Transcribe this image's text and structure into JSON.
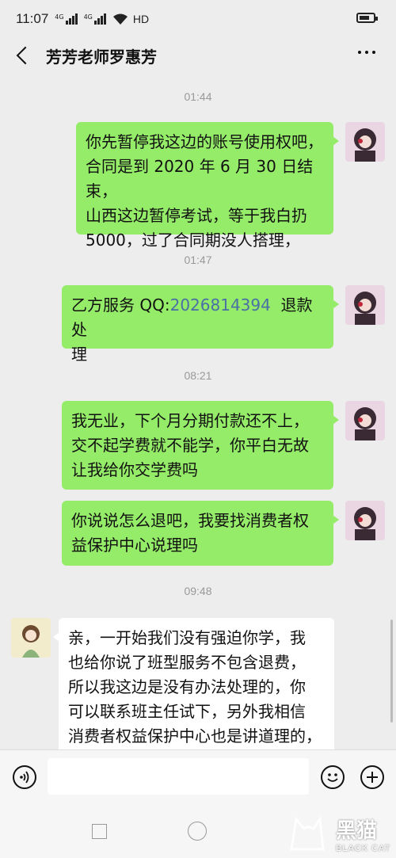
{
  "status": {
    "time": "11:07",
    "net1": "4G",
    "net2": "4G",
    "hd": "HD"
  },
  "header": {
    "title": "芳芳老师罗惠芳"
  },
  "messages": [
    {
      "time": "01:44",
      "text": "你先暂停我这边的账号使用权吧，合同是到 2020 年 6 月 30 日结束，山西这边暂停考试，等于我白扔 5000，过了合同期没人搭理，",
      "lines": [
        "你先暂停我这边的账号使用权吧，",
        "合同是到 2020 年 6 月 30 日结束，",
        "山西这边暂停考试，等于我白扔",
        "5000，过了合同期没人搭理，"
      ]
    },
    {
      "time": "01:47",
      "prefix": "乙方服务 QQ:",
      "qq": "2026814394",
      "suffix": " 退款处理",
      "line2": "理"
    },
    {
      "time": "08:21",
      "lines": [
        "我无业，下个月分期付款还不上，",
        "交不起学费就不能学，你平白无故",
        "让我给你交学费吗"
      ]
    },
    {
      "lines": [
        "你说说怎么退吧，我要找消费者权",
        "益保护中心说理吗"
      ]
    },
    {
      "time": "09:48",
      "lines": [
        "亲，一开始我们没有强迫你学，我",
        "也给你说了班型服务不包含退费，",
        "所以我这边是没有办法处理的，你",
        "可以联系班主任试下，另外我相信",
        "消费者权益保护中心也是讲道理的，"
      ]
    }
  ],
  "ts": [
    "01:44",
    "01:47",
    "08:21",
    "09:48"
  ],
  "watermark": {
    "big": "黑猫",
    "small": "BLACK CAT"
  },
  "icons": [
    "back-icon",
    "more-icon",
    "voice-icon",
    "emoji-icon",
    "plus-icon"
  ]
}
